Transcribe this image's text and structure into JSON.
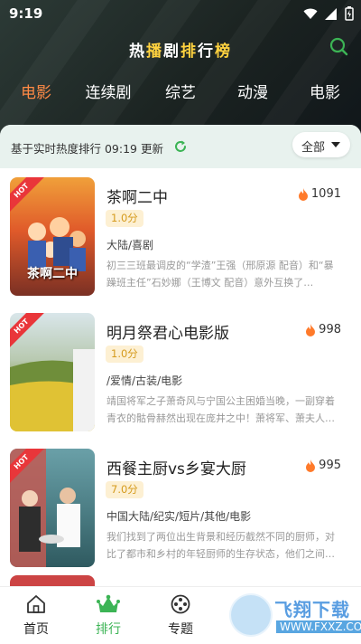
{
  "status_bar": {
    "time": "9:19"
  },
  "app": {
    "title_parts": [
      "热",
      "播",
      "剧",
      "排",
      "行",
      "榜"
    ],
    "categories": [
      "电影",
      "连续剧",
      "综艺",
      "动漫",
      "电影"
    ],
    "active_category": 0
  },
  "list_header": {
    "update_text": "基于实时热度排行 09:19 更新",
    "filter_label": "全部"
  },
  "items": [
    {
      "title": "茶啊二中",
      "heat": "1091",
      "score": "1.0分",
      "genre": "大陆/喜剧",
      "desc": "初三三班最调皮的“学渣”王强（邢原源 配音）和“暴躁班主任”石妙娜（王博文 配音）意外互换了…",
      "poster_text": "茶啊二中",
      "hot_label": "HOT"
    },
    {
      "title": "明月祭君心电影版",
      "heat": "998",
      "score": "1.0分",
      "genre": "/爱情/古装/电影",
      "desc": "靖国将军之子萧奇风与宁国公主困婚当晚，一副穿着青衣的骷骨赫然出现在庞井之中！萧将军、萧夫人…",
      "poster_text": "",
      "hot_label": "HOT"
    },
    {
      "title": "西餐主厨vs乡宴大厨",
      "heat": "995",
      "score": "7.0分",
      "genre": "中国大陆/纪实/短片/其他/电影",
      "desc": "我们找到了两位出生背景和经历截然不同的厨师，对比了都市和乡村的年轻厨师的生存状态，他们之间…",
      "poster_text": "",
      "hot_label": "HOT"
    }
  ],
  "bottom_nav": [
    {
      "label": "首页",
      "icon": "home-icon"
    },
    {
      "label": "排行",
      "icon": "crown-icon",
      "active": true
    },
    {
      "label": "专题",
      "icon": "film-reel-icon"
    },
    {
      "label": "",
      "icon": ""
    }
  ],
  "watermark": {
    "main": "飞翔下载",
    "sub": "WWW.FXXZ.COM"
  },
  "colors": {
    "accent": "#3cb455",
    "active_tab": "#ff8a45",
    "hot_badge": "#e9363a",
    "score_text": "#d59a1c"
  }
}
